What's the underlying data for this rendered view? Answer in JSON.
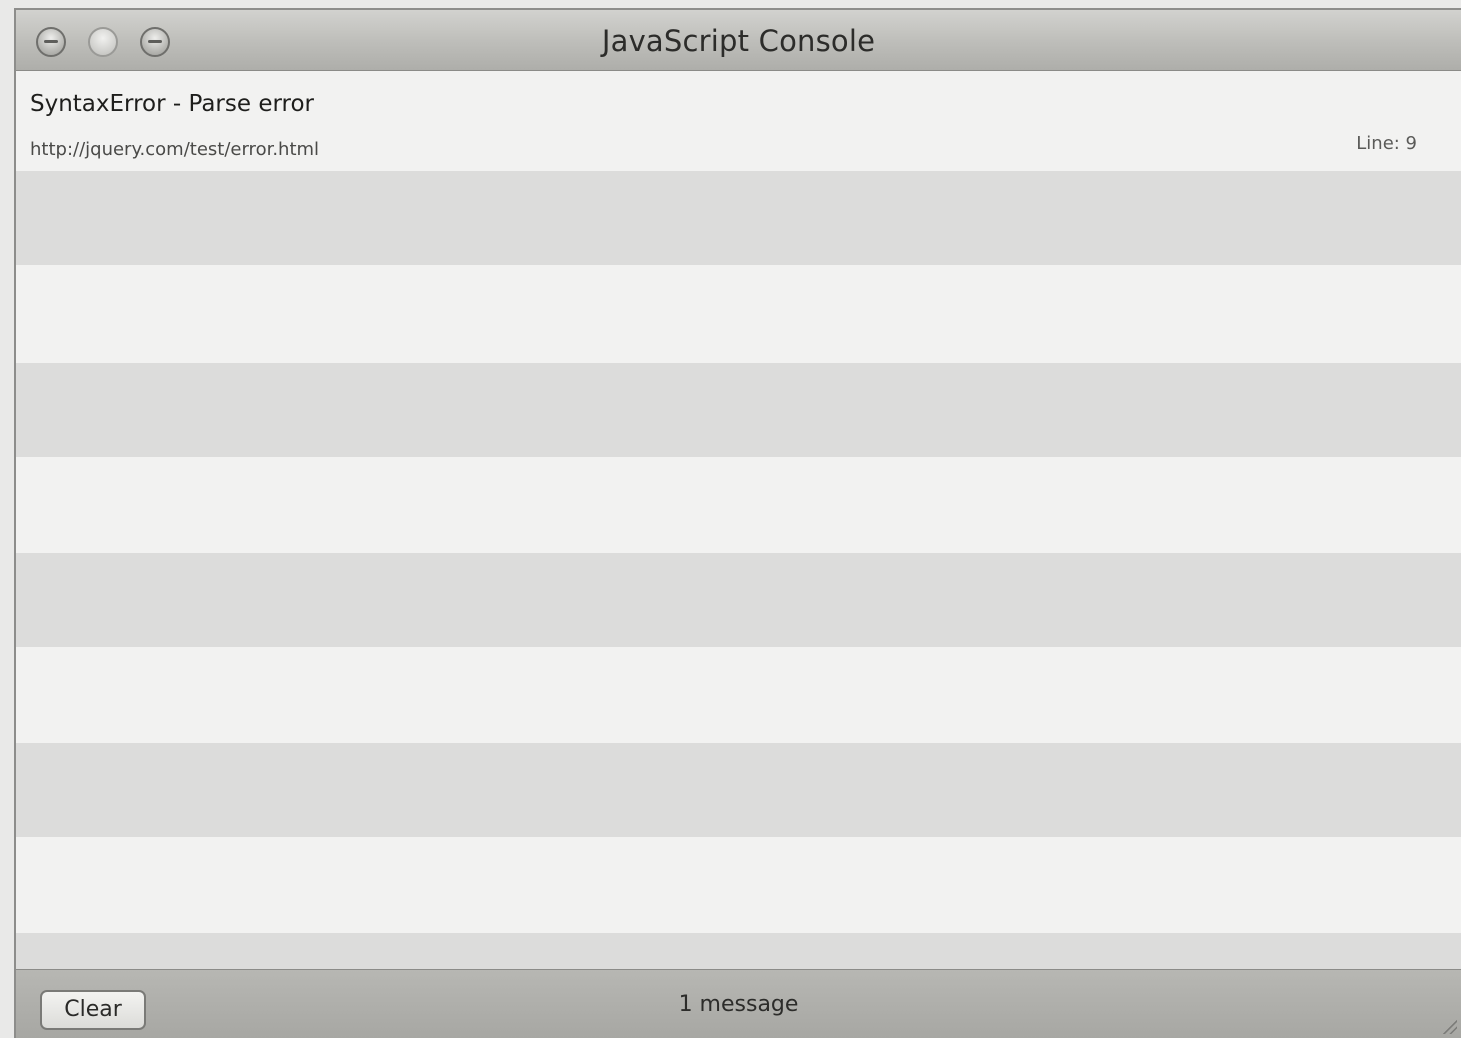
{
  "window": {
    "title": "JavaScript Console",
    "controls": [
      "close",
      "minimize",
      "zoom"
    ]
  },
  "console": {
    "entries": [
      {
        "message": "SyntaxError - Parse error",
        "url": "http://jquery.com/test/error.html",
        "line_text": "Line: 9"
      }
    ],
    "row_stripe_color": "#dcdcdb"
  },
  "footer": {
    "clear_label": "Clear",
    "status": "1 message"
  }
}
